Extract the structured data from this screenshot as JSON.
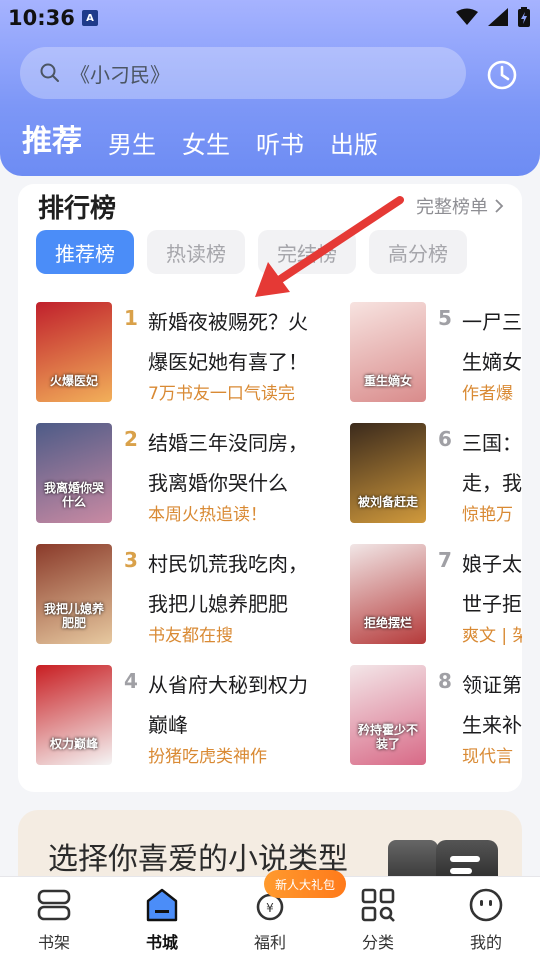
{
  "status_bar": {
    "time": "10:36",
    "notification_badge": "A"
  },
  "search": {
    "placeholder": "《小刁民》"
  },
  "tabs": [
    {
      "label": "推荐",
      "active": true
    },
    {
      "label": "男生"
    },
    {
      "label": "女生"
    },
    {
      "label": "听书"
    },
    {
      "label": "出版"
    }
  ],
  "ranking": {
    "title": "排行榜",
    "full_list_label": "完整榜单",
    "chips": [
      {
        "label": "推荐榜",
        "active": true
      },
      {
        "label": "热读榜"
      },
      {
        "label": "完结榜"
      },
      {
        "label": "高分榜"
      }
    ],
    "books": [
      {
        "rank": "1",
        "line1": "新婚夜被赐死？火",
        "line2": "爆医妃她有喜了！",
        "tagline": "7万书友一口气读完",
        "cover_text": "火爆医妃",
        "cover_colors": [
          "#c0202c",
          "#f2b05a"
        ]
      },
      {
        "rank": "2",
        "line1": "结婚三年没同房，",
        "line2": "我离婚你哭什么",
        "tagline": "本周火热追读！",
        "cover_text": "我离婚你哭什么",
        "cover_colors": [
          "#4d5b87",
          "#c98aa3"
        ]
      },
      {
        "rank": "3",
        "line1": "村民饥荒我吃肉，",
        "line2": "我把儿媳养肥肥",
        "tagline": "书友都在搜",
        "cover_text": "我把儿媳养肥肥",
        "cover_colors": [
          "#8a3a2a",
          "#e7c9a0"
        ]
      },
      {
        "rank": "4",
        "line1": "从省府大秘到权力",
        "line2": "巅峰",
        "tagline": "扮猪吃虎类神作",
        "cover_text": "权力巅峰",
        "cover_colors": [
          "#c81e22",
          "#f5f5f5"
        ]
      },
      {
        "rank": "5",
        "line1": "一尸三",
        "line2": "生嫡女",
        "tagline": "作者爆",
        "cover_text": "重生嫡女",
        "cover_colors": [
          "#f7e3e0",
          "#d98b8b"
        ]
      },
      {
        "rank": "6",
        "line1": "三国：",
        "line2": "走，我",
        "tagline": "惊艳万",
        "cover_text": "被刘备赶走",
        "cover_colors": [
          "#3b2a1c",
          "#d19a3c"
        ]
      },
      {
        "rank": "7",
        "line1": "娘子太",
        "line2": "世子拒",
        "tagline": "爽文 | 架",
        "cover_text": "拒绝摆烂",
        "cover_colors": [
          "#f1e6e6",
          "#b53a3a"
        ]
      },
      {
        "rank": "8",
        "line1": "领证第",
        "line2": "生来补",
        "tagline": "现代言",
        "cover_text": "矜持霍少不装了",
        "cover_colors": [
          "#f3e6e8",
          "#d86a87"
        ]
      }
    ]
  },
  "preference_banner": {
    "text": "选择你喜爱的小说类型"
  },
  "bottom_nav": {
    "items": [
      {
        "label": "书架",
        "icon": "bookshelf-icon"
      },
      {
        "label": "书城",
        "icon": "bookstore-icon",
        "active": true
      },
      {
        "label": "福利",
        "icon": "welfare-icon"
      },
      {
        "label": "分类",
        "icon": "category-icon"
      },
      {
        "label": "我的",
        "icon": "profile-icon"
      }
    ],
    "gift_badge": "新人大礼包"
  },
  "colors": {
    "header_top": "#a6b3ff",
    "header_bottom": "#6d8cf3",
    "accent_blue": "#4b8df8",
    "tagline_orange": "#d98a34",
    "rank_top3": "#d9a14a",
    "rank_other": "#a0a0a5",
    "annotation_arrow": "#e53935"
  }
}
